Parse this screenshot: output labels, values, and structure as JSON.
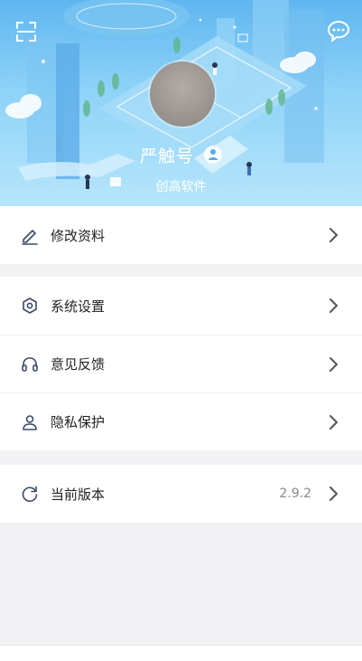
{
  "profile": {
    "name": "严触号",
    "company": "创高软件"
  },
  "menu": {
    "edit_profile": "修改资料",
    "system_settings": "系统设置",
    "feedback": "意见反馈",
    "privacy": "隐私保护",
    "version_label": "当前版本",
    "version_value": "2.9.2"
  },
  "icons": {
    "scan": "scan-icon",
    "message": "message-icon",
    "edit": "pencil-icon",
    "settings": "hexagon-settings-icon",
    "feedback": "headset-icon",
    "privacy": "user-icon",
    "version": "refresh-icon",
    "chevron": "chevron-right-icon"
  },
  "colors": {
    "header_top": "#5fb6f0",
    "header_bottom": "#b7e6fb",
    "icon_stroke": "#3b4a66",
    "chevron": "#555555"
  }
}
